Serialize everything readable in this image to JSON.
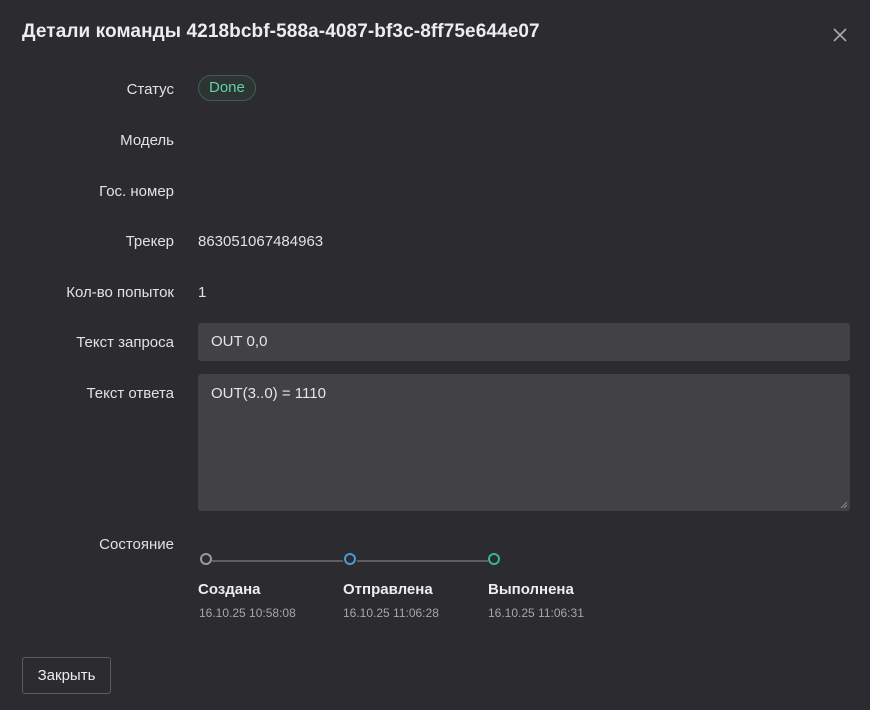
{
  "dialog": {
    "title": "Детали команды 4218bcbf-588a-4087-bf3c-8ff75e644e07",
    "close_icon": "close-icon"
  },
  "fields": {
    "status_label": "Статус",
    "status_value": "Done",
    "model_label": "Модель",
    "model_value": "",
    "plate_label": "Гос. номер",
    "plate_value": "",
    "tracker_label": "Трекер",
    "tracker_value": "863051067484963",
    "attempts_label": "Кол-во попыток",
    "attempts_value": "1",
    "request_label": "Текст запроса",
    "request_value": "OUT 0,0",
    "response_label": "Текст ответа",
    "response_value": "OUT(3..0) = 1110",
    "state_label": "Состояние"
  },
  "timeline": {
    "steps": [
      {
        "label": "Создана",
        "time": "16.10.25 10:58:08",
        "color": "#9a9aa0"
      },
      {
        "label": "Отправлена",
        "time": "16.10.25 11:06:28",
        "color": "#4a9ad6"
      },
      {
        "label": "Выполнена",
        "time": "16.10.25 11:06:31",
        "color": "#35b59a"
      }
    ]
  },
  "footer": {
    "close_label": "Закрыть"
  },
  "colors": {
    "background": "#2b2b30",
    "field_background": "#414146",
    "status_accent": "#5fd1b0"
  }
}
